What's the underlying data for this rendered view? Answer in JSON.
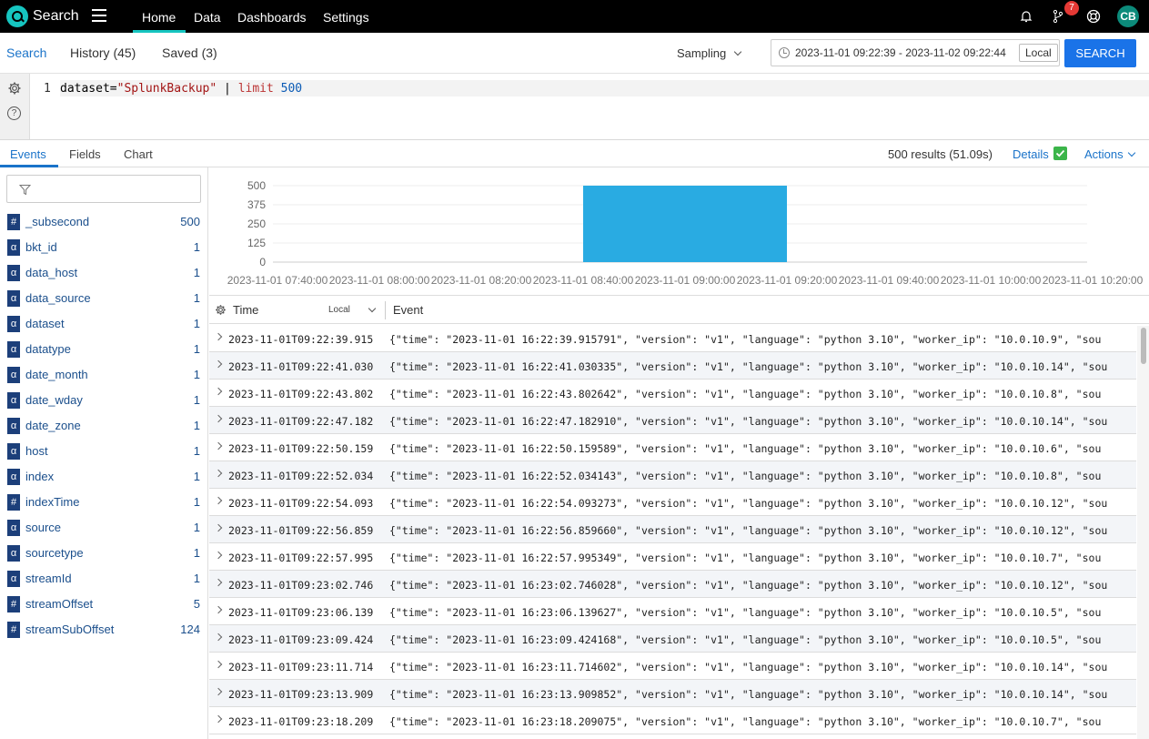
{
  "topnav": {
    "app_name": "Search",
    "items": [
      "Home",
      "Data",
      "Dashboards",
      "Settings"
    ],
    "notification_count": "7",
    "user_initials": "CB"
  },
  "search_header": {
    "tabs": [
      "Search",
      "History (45)",
      "Saved (3)"
    ],
    "sampling_label": "Sampling",
    "time_range": "2023-11-01 09:22:39 - 2023-11-02 09:22:44",
    "timezone_label": "Local",
    "search_button": "SEARCH"
  },
  "query": {
    "line_number": "1",
    "key": "dataset=",
    "value": "\"SplunkBackup\"",
    "pipe": " | ",
    "command": "limit",
    "arg": " 500"
  },
  "result_tabs": {
    "tabs": [
      "Events",
      "Fields",
      "Chart"
    ],
    "count": "500 results (51.09s)",
    "details": "Details",
    "actions": "Actions"
  },
  "fields": [
    {
      "type": "#",
      "name": "_subsecond",
      "count": "500"
    },
    {
      "type": "α",
      "name": "bkt_id",
      "count": "1"
    },
    {
      "type": "α",
      "name": "data_host",
      "count": "1"
    },
    {
      "type": "α",
      "name": "data_source",
      "count": "1"
    },
    {
      "type": "α",
      "name": "dataset",
      "count": "1"
    },
    {
      "type": "α",
      "name": "datatype",
      "count": "1"
    },
    {
      "type": "α",
      "name": "date_month",
      "count": "1"
    },
    {
      "type": "α",
      "name": "date_wday",
      "count": "1"
    },
    {
      "type": "α",
      "name": "date_zone",
      "count": "1"
    },
    {
      "type": "α",
      "name": "host",
      "count": "1"
    },
    {
      "type": "α",
      "name": "index",
      "count": "1"
    },
    {
      "type": "#",
      "name": "indexTime",
      "count": "1"
    },
    {
      "type": "α",
      "name": "source",
      "count": "1"
    },
    {
      "type": "α",
      "name": "sourcetype",
      "count": "1"
    },
    {
      "type": "α",
      "name": "streamId",
      "count": "1"
    },
    {
      "type": "#",
      "name": "streamOffset",
      "count": "5"
    },
    {
      "type": "#",
      "name": "streamSubOffset",
      "count": "124"
    }
  ],
  "chart_data": {
    "type": "bar",
    "y_ticks": [
      "500",
      "375",
      "250",
      "125",
      "0"
    ],
    "ylim": [
      0,
      500
    ],
    "x_ticks": [
      "2023-11-01 07:40:00",
      "2023-11-01 08:00:00",
      "2023-11-01 08:20:00",
      "2023-11-01 08:40:00",
      "2023-11-01 09:00:00",
      "2023-11-01 09:20:00",
      "2023-11-01 09:40:00",
      "2023-11-01 10:00:00",
      "2023-11-01 10:20:00"
    ],
    "bars": [
      {
        "start": "2023-11-01 08:40:00",
        "end": "2023-11-01 09:20:00",
        "value": 500
      }
    ],
    "color": "#29abe2"
  },
  "events_table": {
    "col_time": "Time",
    "col_tz": "Local",
    "col_event": "Event",
    "rows": [
      {
        "time": "2023-11-01T09:22:39.915",
        "event": "{\"time\": \"2023-11-01 16:22:39.915791\", \"version\": \"v1\", \"language\": \"python 3.10\", \"worker_ip\": \"10.0.10.9\", \"sou"
      },
      {
        "time": "2023-11-01T09:22:41.030",
        "event": "{\"time\": \"2023-11-01 16:22:41.030335\", \"version\": \"v1\", \"language\": \"python 3.10\", \"worker_ip\": \"10.0.10.14\", \"sou"
      },
      {
        "time": "2023-11-01T09:22:43.802",
        "event": "{\"time\": \"2023-11-01 16:22:43.802642\", \"version\": \"v1\", \"language\": \"python 3.10\", \"worker_ip\": \"10.0.10.8\", \"sou"
      },
      {
        "time": "2023-11-01T09:22:47.182",
        "event": "{\"time\": \"2023-11-01 16:22:47.182910\", \"version\": \"v1\", \"language\": \"python 3.10\", \"worker_ip\": \"10.0.10.14\", \"sou"
      },
      {
        "time": "2023-11-01T09:22:50.159",
        "event": "{\"time\": \"2023-11-01 16:22:50.159589\", \"version\": \"v1\", \"language\": \"python 3.10\", \"worker_ip\": \"10.0.10.6\", \"sou"
      },
      {
        "time": "2023-11-01T09:22:52.034",
        "event": "{\"time\": \"2023-11-01 16:22:52.034143\", \"version\": \"v1\", \"language\": \"python 3.10\", \"worker_ip\": \"10.0.10.8\", \"sou"
      },
      {
        "time": "2023-11-01T09:22:54.093",
        "event": "{\"time\": \"2023-11-01 16:22:54.093273\", \"version\": \"v1\", \"language\": \"python 3.10\", \"worker_ip\": \"10.0.10.12\", \"sou"
      },
      {
        "time": "2023-11-01T09:22:56.859",
        "event": "{\"time\": \"2023-11-01 16:22:56.859660\", \"version\": \"v1\", \"language\": \"python 3.10\", \"worker_ip\": \"10.0.10.12\", \"sou"
      },
      {
        "time": "2023-11-01T09:22:57.995",
        "event": "{\"time\": \"2023-11-01 16:22:57.995349\", \"version\": \"v1\", \"language\": \"python 3.10\", \"worker_ip\": \"10.0.10.7\", \"sou"
      },
      {
        "time": "2023-11-01T09:23:02.746",
        "event": "{\"time\": \"2023-11-01 16:23:02.746028\", \"version\": \"v1\", \"language\": \"python 3.10\", \"worker_ip\": \"10.0.10.12\", \"sou"
      },
      {
        "time": "2023-11-01T09:23:06.139",
        "event": "{\"time\": \"2023-11-01 16:23:06.139627\", \"version\": \"v1\", \"language\": \"python 3.10\", \"worker_ip\": \"10.0.10.5\", \"sou"
      },
      {
        "time": "2023-11-01T09:23:09.424",
        "event": "{\"time\": \"2023-11-01 16:23:09.424168\", \"version\": \"v1\", \"language\": \"python 3.10\", \"worker_ip\": \"10.0.10.5\", \"sou"
      },
      {
        "time": "2023-11-01T09:23:11.714",
        "event": "{\"time\": \"2023-11-01 16:23:11.714602\", \"version\": \"v1\", \"language\": \"python 3.10\", \"worker_ip\": \"10.0.10.14\", \"sou"
      },
      {
        "time": "2023-11-01T09:23:13.909",
        "event": "{\"time\": \"2023-11-01 16:23:13.909852\", \"version\": \"v1\", \"language\": \"python 3.10\", \"worker_ip\": \"10.0.10.14\", \"sou"
      },
      {
        "time": "2023-11-01T09:23:18.209",
        "event": "{\"time\": \"2023-11-01 16:23:18.209075\", \"version\": \"v1\", \"language\": \"python 3.10\", \"worker_ip\": \"10.0.10.7\", \"sou"
      }
    ]
  }
}
